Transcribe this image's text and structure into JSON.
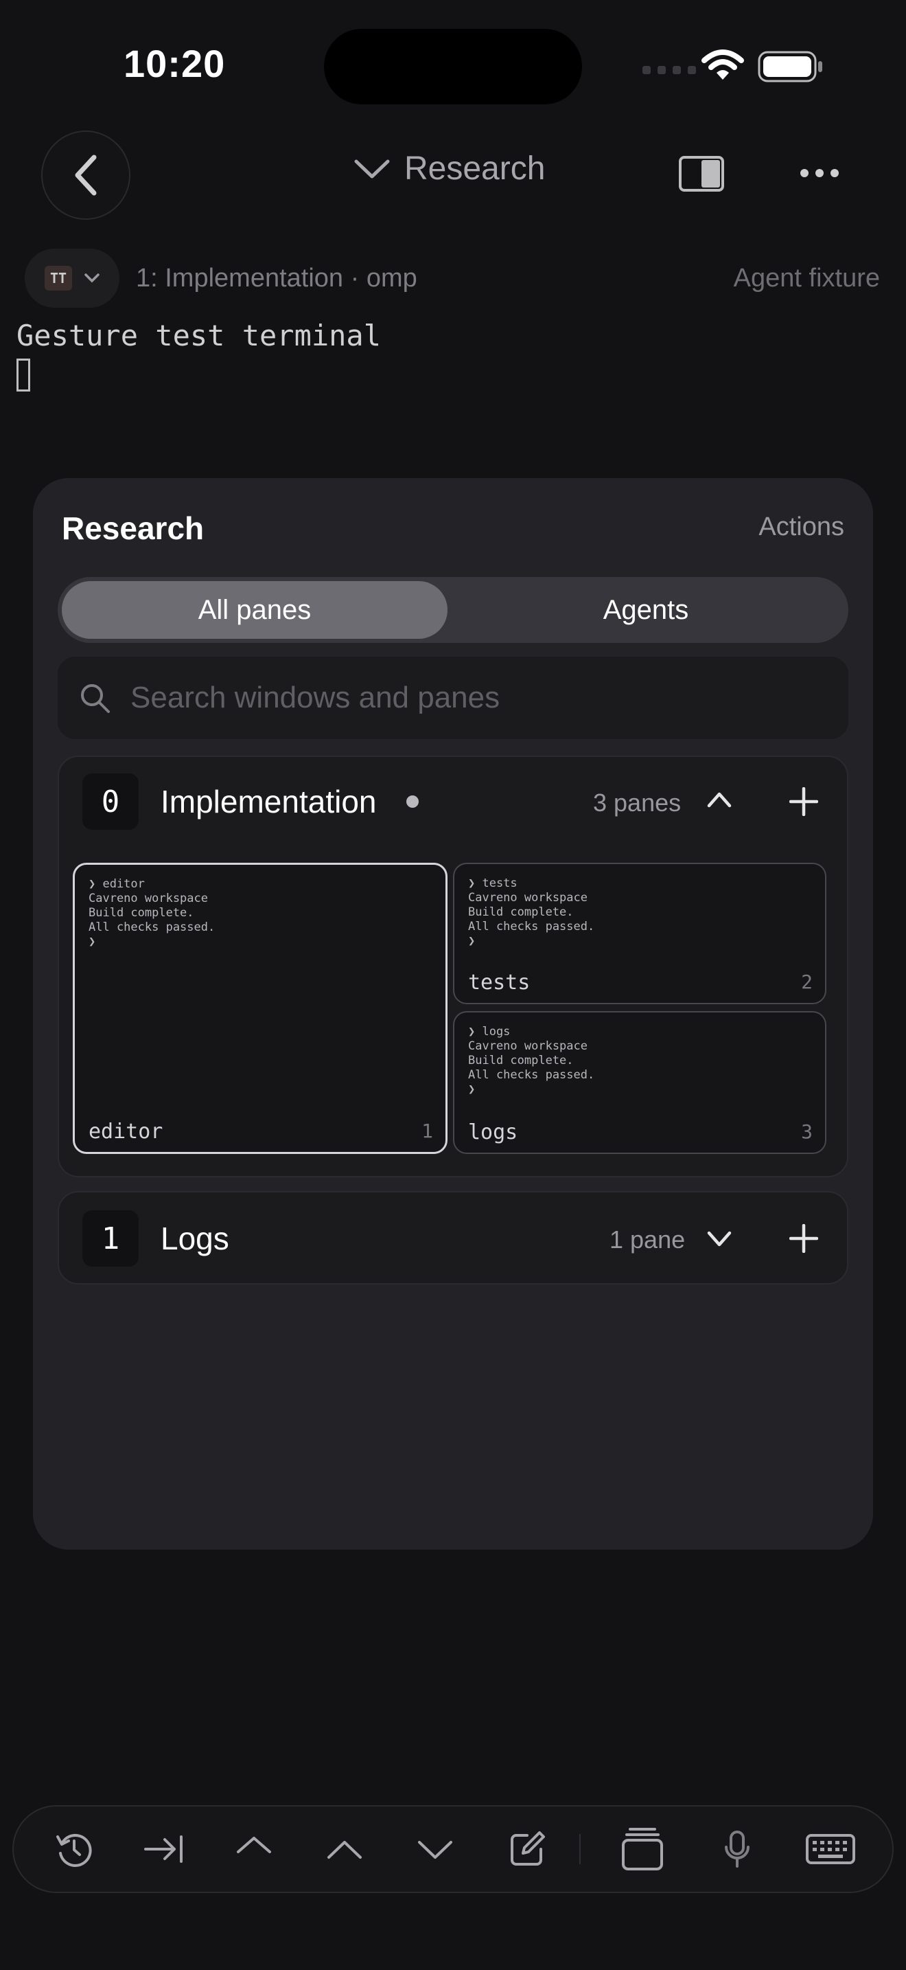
{
  "status_bar": {
    "time": "10:20"
  },
  "nav": {
    "title": "Research"
  },
  "session": {
    "chip_label": "TT",
    "label": "1: Implementation · omp",
    "right_label": "Agent fixture"
  },
  "terminal": {
    "line1": "Gesture test terminal"
  },
  "sheet": {
    "title": "Research",
    "actions_label": "Actions",
    "tabs": [
      {
        "label": "All panes",
        "selected": true
      },
      {
        "label": "Agents",
        "selected": false
      }
    ],
    "search_placeholder": "Search windows and panes",
    "windows": [
      {
        "index": "0",
        "title": "Implementation",
        "pane_count": "3 panes",
        "expanded": true,
        "panes": [
          {
            "name": "editor",
            "num": "1",
            "preview": "❯ editor\nCavreno workspace\nBuild complete.\nAll checks passed.\n❯"
          },
          {
            "name": "tests",
            "num": "2",
            "preview": "❯ tests\nCavreno workspace\nBuild complete.\nAll checks passed.\n❯"
          },
          {
            "name": "logs",
            "num": "3",
            "preview": "❯ logs\nCavreno workspace\nBuild complete.\nAll checks passed.\n❯"
          }
        ]
      },
      {
        "index": "1",
        "title": "Logs",
        "pane_count": "1 pane",
        "expanded": false
      }
    ]
  },
  "toolbar": {
    "items": [
      "history-icon",
      "tab-key-icon",
      "ctrl-key-icon",
      "arrow-up-icon",
      "arrow-down-icon",
      "compose-icon",
      "windows-stack-icon",
      "microphone-icon",
      "keyboard-icon"
    ]
  },
  "colors": {
    "background": "#121214",
    "sheet": "#232327",
    "accent_text": "#ffffff"
  }
}
